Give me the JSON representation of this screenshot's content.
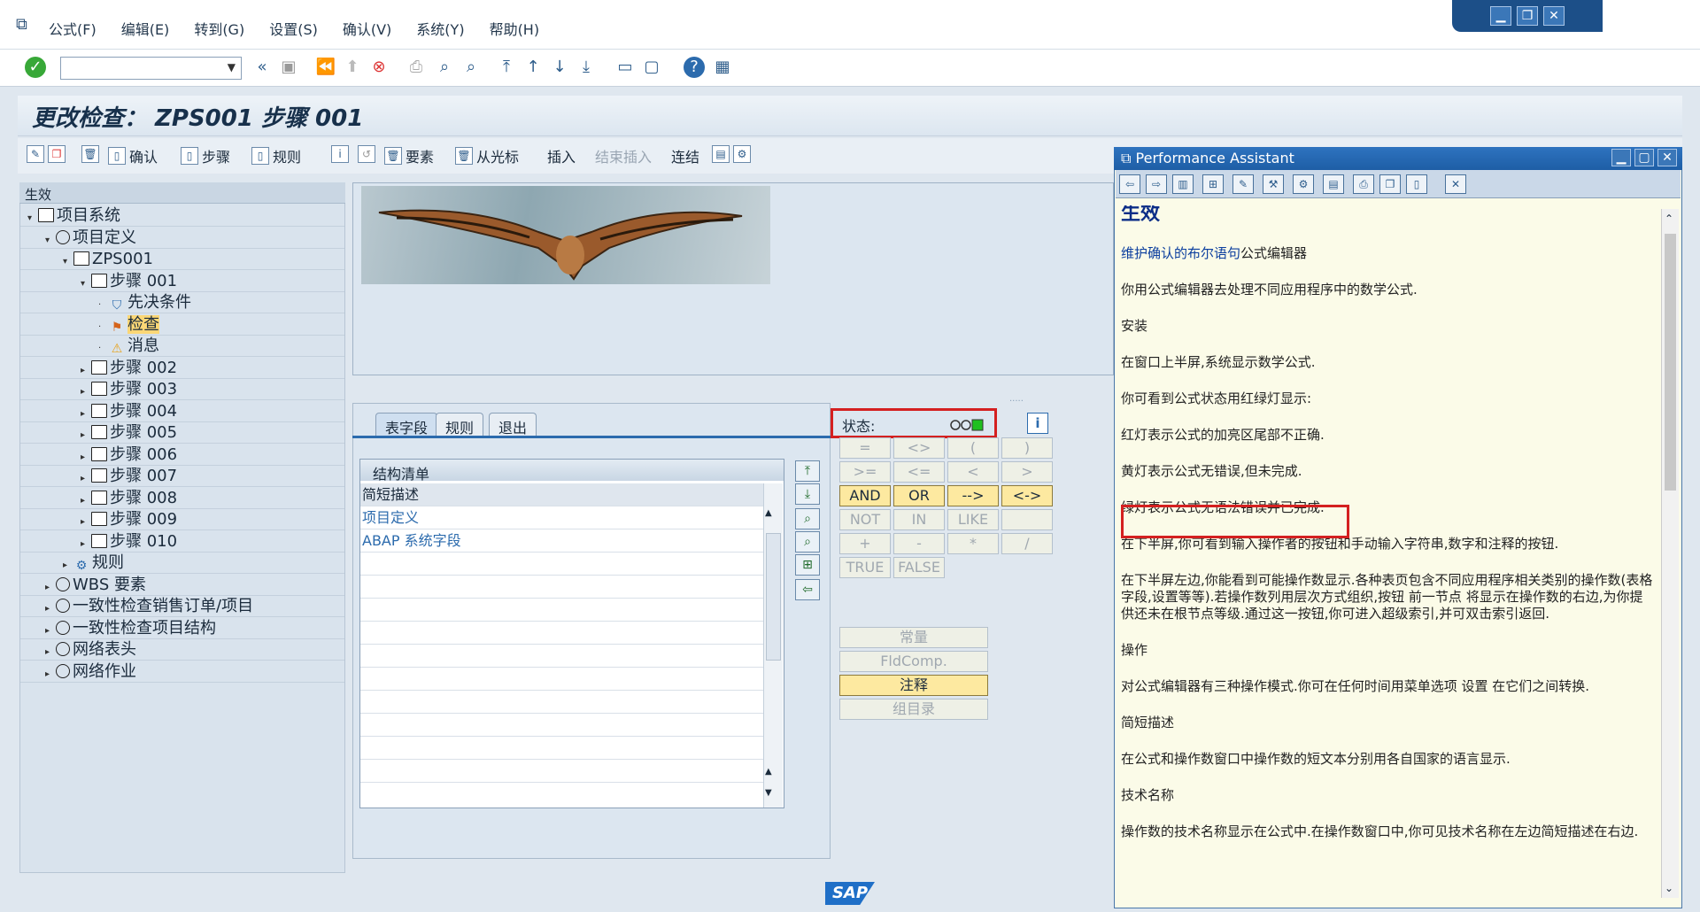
{
  "menu": [
    "公式(F)",
    "编辑(E)",
    "转到(G)",
    "设置(S)",
    "确认(V)",
    "系统(Y)",
    "帮助(H)"
  ],
  "window_controls": [
    "minimize",
    "restore",
    "close"
  ],
  "title": "更改检查： ZPS001 步骤 001",
  "app_toolbar": {
    "confirm": "确认",
    "step": "步骤",
    "rule": "规则",
    "element": "要素",
    "from_cursor": "从光标",
    "insert": "插入",
    "end_insert": "结束插入",
    "link": "连结"
  },
  "tree": {
    "header": "生效",
    "rows": [
      {
        "label": "项目系统",
        "arrow": "▾",
        "icon": "folder"
      },
      {
        "label": "项目定义",
        "arrow": "▾",
        "icon": "clock"
      },
      {
        "label": "ZPS001",
        "arrow": "▾",
        "icon": "folder"
      },
      {
        "label": "步骤 001",
        "arrow": "▾",
        "icon": "folder"
      },
      {
        "label": "先决条件",
        "arrow": "·",
        "icon": "filter"
      },
      {
        "label": "检查",
        "arrow": "·",
        "icon": "check"
      },
      {
        "label": "消息",
        "arrow": "·",
        "icon": "warn"
      },
      {
        "label": "步骤 002",
        "arrow": "▸",
        "icon": "folder"
      },
      {
        "label": "步骤 003",
        "arrow": "▸",
        "icon": "folder"
      },
      {
        "label": "步骤 004",
        "arrow": "▸",
        "icon": "folder"
      },
      {
        "label": "步骤 005",
        "arrow": "▸",
        "icon": "folder"
      },
      {
        "label": "步骤 006",
        "arrow": "▸",
        "icon": "folder"
      },
      {
        "label": "步骤 007",
        "arrow": "▸",
        "icon": "folder"
      },
      {
        "label": "步骤 008",
        "arrow": "▸",
        "icon": "folder"
      },
      {
        "label": "步骤 009",
        "arrow": "▸",
        "icon": "folder"
      },
      {
        "label": "步骤 010",
        "arrow": "▸",
        "icon": "folder"
      },
      {
        "label": "规则",
        "arrow": "▸",
        "icon": "rule"
      },
      {
        "label": "WBS 要素",
        "arrow": "▸",
        "icon": "clock"
      },
      {
        "label": "一致性检查销售订单/项目",
        "arrow": "▸",
        "icon": "clock"
      },
      {
        "label": "一致性检查项目结构",
        "arrow": "▸",
        "icon": "clock"
      },
      {
        "label": "网络表头",
        "arrow": "▸",
        "icon": "clock"
      },
      {
        "label": "网络作业",
        "arrow": "▸",
        "icon": "clock"
      }
    ]
  },
  "tabs": [
    "表字段",
    "规则",
    "退出"
  ],
  "list": {
    "header": "结构清单",
    "rows": [
      "简短描述",
      "项目定义",
      "ABAP 系统字段"
    ]
  },
  "status_label": "状态:",
  "operators": [
    [
      "=",
      "<>",
      "(",
      ")"
    ],
    [
      ">=",
      "<=",
      "<",
      ">"
    ],
    [
      "AND",
      "OR",
      "-->",
      "<->"
    ],
    [
      "NOT",
      "IN",
      "LIKE",
      ""
    ],
    [
      "+",
      "-",
      "*",
      "/"
    ],
    [
      "TRUE",
      "FALSE",
      "",
      ""
    ]
  ],
  "wide_buttons": [
    "常量",
    "FldComp.",
    "注释",
    "组目录"
  ],
  "pa": {
    "title": "Performance Assistant",
    "heading": "生效",
    "link": "维护确认的布尔语句",
    "link_suffix": "公式编辑器",
    "paragraphs": [
      "你用公式编辑器去处理不同应用程序中的数学公式.",
      "安装",
      "在窗口上半屏,系统显示数学公式.",
      "你可看到公式状态用红绿灯显示:",
      "红灯表示公式的加亮区尾部不正确.",
      "黄灯表示公式无错误,但未完成.",
      "绿灯表示公式无语法错误并已完成.",
      "在下半屏,你可看到输入操作者的按钮和手动输入字符串,数字和注释的按钮.",
      "在下半屏左边,你能看到可能操作数显示.各种表页包含不同应用程序相关类别的操作数(表格字段,设置等等).若操作数列用层次方式组织,按钮 前一节点 将显示在操作数的右边,为你提供还未在根节点等级.通过这一按钮,你可进入超级索引,并可双击索引返回.",
      "操作",
      "对公式编辑器有三种操作模式.你可在任何时间用菜单选项 设置 在它们之间转换.",
      "简短描述",
      "在公式和操作数窗口中操作数的短文本分别用各自国家的语言显示.",
      "技术名称",
      "操作数的技术名称显示在公式中.在操作数窗口中,你可见技术名称在左边简短描述在右边."
    ]
  },
  "brand": "SAP",
  "colors": {
    "highlight": "#d42020",
    "selection": "#fbd776",
    "lamp_green": "#1fc01f"
  }
}
